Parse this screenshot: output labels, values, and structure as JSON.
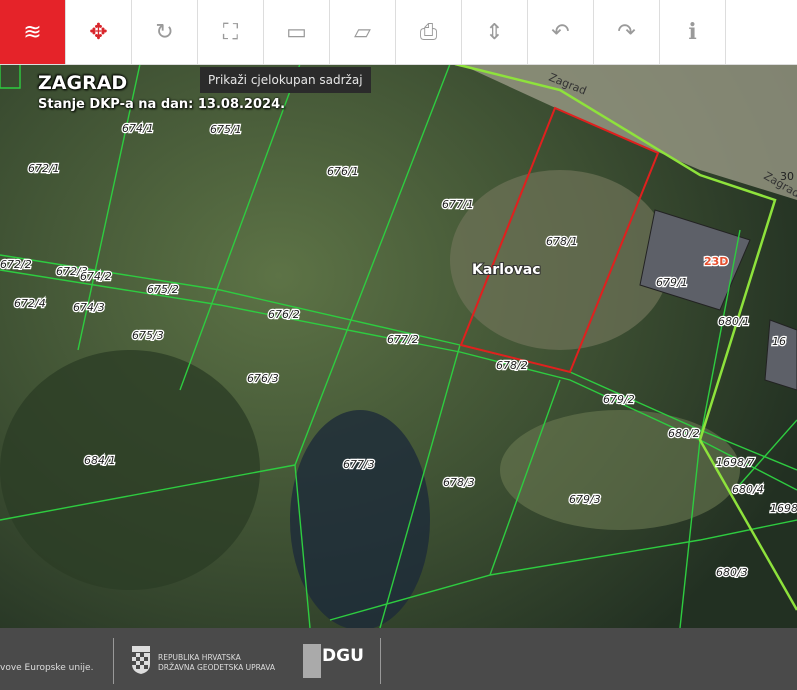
{
  "toolbar": {
    "buttons": [
      {
        "name": "layers",
        "icon": "layers-icon",
        "active": true
      },
      {
        "name": "pan",
        "icon": "move-arrows-icon"
      },
      {
        "name": "refresh",
        "icon": "rotate-icon"
      },
      {
        "name": "full-extent",
        "icon": "expand-icon"
      },
      {
        "name": "add-rectangle",
        "icon": "rectangle-add-icon"
      },
      {
        "name": "edit-rectangle",
        "icon": "rectangle-edit-icon"
      },
      {
        "name": "print",
        "icon": "printer-icon"
      },
      {
        "name": "export",
        "icon": "export-icon"
      },
      {
        "name": "undo",
        "icon": "undo-icon"
      },
      {
        "name": "redo",
        "icon": "redo-icon"
      },
      {
        "name": "info",
        "icon": "info-icon"
      }
    ],
    "tooltip": "Prikaži cjelokupan sadržaj"
  },
  "map": {
    "title": "ZAGRAD",
    "subtitle": "Stanje DKP-a na dan: 13.08.2024.",
    "place_label": "Karlovac",
    "street_labels": [
      "Zagrad",
      "Zagrad",
      "30"
    ],
    "house_number": "23D",
    "parcels": [
      "674/1",
      "675/1",
      "672/1",
      "676/1",
      "677/1",
      "678/1",
      "679/1",
      "680/1",
      "672/2",
      "672/3",
      "674/2",
      "675/2",
      "672/4",
      "674/3",
      "676/2",
      "677/2",
      "675/3",
      "678/2",
      "676/3",
      "679/2",
      "680/2",
      "1698/7",
      "684/1",
      "677/3",
      "678/3",
      "680/4",
      "679/3",
      "1698",
      "680/3",
      "16"
    ],
    "colors": {
      "accent": "#e52329",
      "parcel_line": "#2ecc40",
      "selected_parcel": "#e0201e",
      "boundary": "#8ee23c"
    }
  },
  "footer": {
    "eu_text": "vove Europske unije.",
    "org_line1": "REPUBLIKA HRVATSKA",
    "org_line2": "DRŽAVNA GEODETSKA UPRAVA",
    "dgu": "DGU"
  }
}
